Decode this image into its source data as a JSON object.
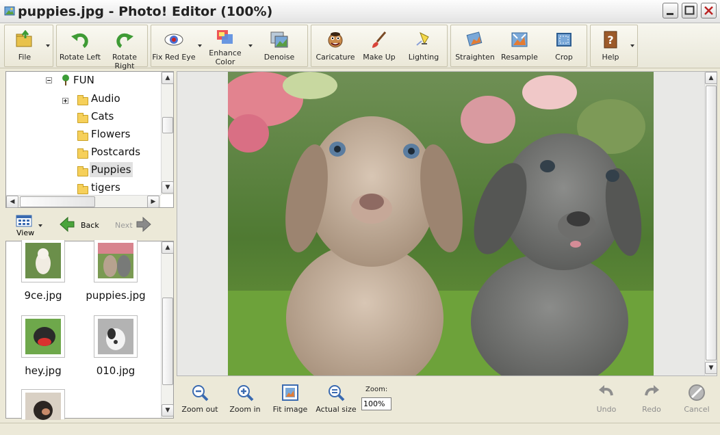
{
  "window": {
    "title": "puppies.jpg - Photo! Editor (100%)"
  },
  "toolbar": {
    "file": "File",
    "rotate_left": "Rotate Left",
    "rotate_right": "Rotate Right",
    "fix_red_eye": "Fix Red Eye",
    "enhance_color_1": "Enhance",
    "enhance_color_2": "Color",
    "denoise": "Denoise",
    "caricature": "Caricature",
    "make_up": "Make Up",
    "lighting": "Lighting",
    "straighten": "Straighten",
    "resample": "Resample",
    "crop": "Crop",
    "help": "Help"
  },
  "tree": {
    "root": "FUN",
    "items": [
      "Audio",
      "Cats",
      "Flowers",
      "Postcards",
      "Puppies",
      "tigers"
    ],
    "selected": "Puppies"
  },
  "nav": {
    "view": "View",
    "back": "Back",
    "next": "Next"
  },
  "files": [
    {
      "name": "9ce.jpg"
    },
    {
      "name": "puppies.jpg"
    },
    {
      "name": "hey.jpg"
    },
    {
      "name": "010.jpg"
    }
  ],
  "bottom": {
    "zoom_out": "Zoom out",
    "zoom_in": "Zoom in",
    "fit_image": "Fit image",
    "actual_size": "Actual size",
    "zoom_label": "Zoom:",
    "zoom_value": "100%",
    "undo": "Undo",
    "redo": "Redo",
    "cancel": "Cancel"
  },
  "colors": {
    "accent_green": "#4aa43b",
    "folder_yellow": "#f6d05a",
    "window_bg": "#ece9d8"
  }
}
